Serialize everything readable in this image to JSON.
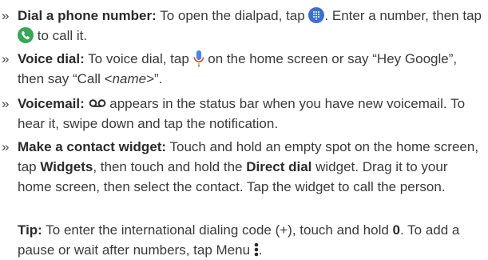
{
  "marker": "»",
  "items": [
    {
      "title": "Dial a phone number:",
      "t1": " To open the dialpad, tap ",
      "t2": ". Enter a number, then tap ",
      "t3": " to call it."
    },
    {
      "title": "Voice dial:",
      "t1": " To voice dial, tap ",
      "t2": " on the home screen or say “Hey Google”, then say “Call <",
      "name": "name",
      "t3": ">”."
    },
    {
      "title": "Voicemail:",
      "t1": " ",
      "t2": " appears in the status bar when you have new voicemail. To hear it, swipe down and tap the notification."
    },
    {
      "title": "Make a contact widget:",
      "t1": " Touch and hold an empty spot on the home screen, tap ",
      "b1": "Widgets",
      "t2": ", then touch and hold the ",
      "b2": "Direct dial",
      "t3": " widget. Drag it to your home screen, then select the contact. Tap the widget to call the person."
    }
  ],
  "tip": {
    "label": "Tip:",
    "t1": " To enter the international dialing code (+), touch and hold ",
    "b1": "0",
    "t2": ". To add a pause or wait after numbers, tap Menu ",
    "t3": "."
  },
  "icons": {
    "dialpad": "dialpad-icon",
    "phone": "phone-call-icon",
    "mic": "microphone-icon",
    "voicemail": "voicemail-icon",
    "menu": "menu-more-icon"
  },
  "colors": {
    "dialpad_blue": "#3b6fd4",
    "phone_green": "#34a853",
    "mic_blue": "#4285f4",
    "mic_red": "#ea4335",
    "mic_yellow": "#fbbc04"
  }
}
